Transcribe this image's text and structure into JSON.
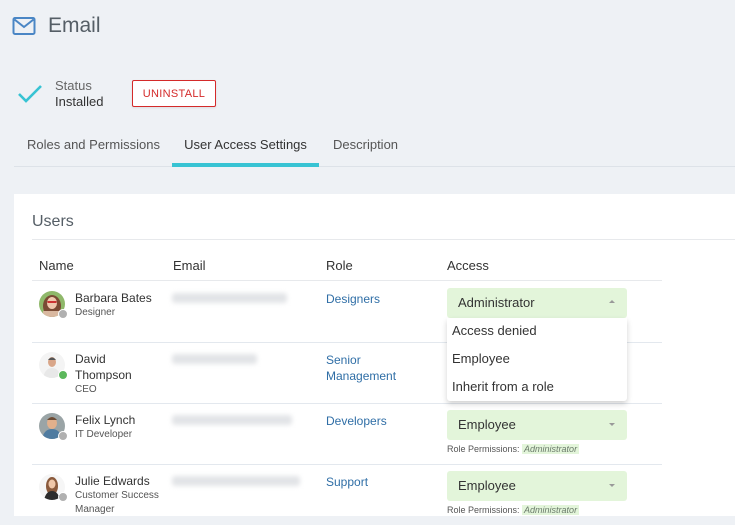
{
  "header": {
    "title": "Email",
    "icon": "mail-icon"
  },
  "status": {
    "label": "Status",
    "value": "Installed",
    "icon": "check-icon",
    "uninstall_label": "UNINSTALL"
  },
  "tabs": [
    {
      "label": "Roles and Permissions",
      "active": false
    },
    {
      "label": "User Access Settings",
      "active": true
    },
    {
      "label": "Description",
      "active": false
    }
  ],
  "users_section": {
    "title": "Users",
    "columns": [
      "Name",
      "Email",
      "Role",
      "Access"
    ],
    "rows": [
      {
        "name": "Barbara Bates",
        "position": "Designer",
        "role": "Designers",
        "access": "Administrator",
        "presence": "offline",
        "role_permissions": null
      },
      {
        "name": "David Thompson",
        "position": "CEO",
        "role": "Senior Management",
        "access": "",
        "presence": "online",
        "role_permissions": null
      },
      {
        "name": "Felix Lynch",
        "position": "IT Developer",
        "role": "Developers",
        "access": "Employee",
        "presence": "offline",
        "role_permissions": {
          "label": "Role Permissions:",
          "value": "Administrator"
        }
      },
      {
        "name": "Julie Edwards",
        "position": "Customer Success Manager",
        "role": "Support",
        "access": "Employee",
        "presence": "offline",
        "role_permissions": {
          "label": "Role Permissions:",
          "value": "Administrator"
        }
      }
    ]
  },
  "access_dropdown": {
    "open_for_row": 0,
    "options": [
      "Access denied",
      "Employee",
      "Inherit from a role"
    ]
  },
  "colors": {
    "accent": "#37c3d3",
    "danger": "#d42a2a",
    "link": "#2f6ea6",
    "select_bg": "#e3f5da",
    "online": "#5cb85c",
    "offline": "#b0b0b0"
  }
}
